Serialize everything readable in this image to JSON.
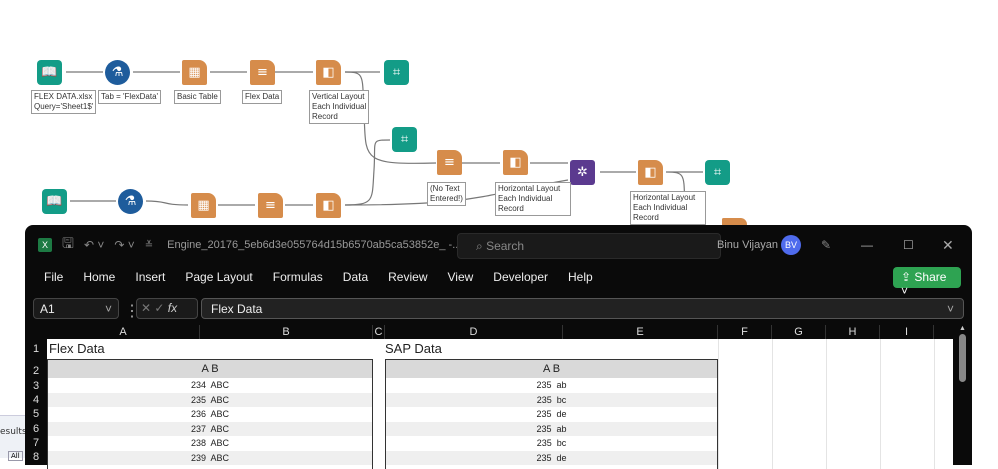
{
  "workflow": {
    "labels": {
      "input1": "FLEX DATA.xlsx\nQuery='Sheet1$'",
      "formula1": "Tab = 'FlexData'",
      "table1": "Basic Table",
      "filter1": "Flex Data",
      "layout1": "Vertical Layout\nEach Individual\nRecord",
      "filter2": "(No Text\nEntered!)",
      "layout2": "Horizontal Layout\nEach Individual\nRecord",
      "layout3": "Horizontal Layout\nEach Individual\nRecord"
    },
    "results_tab": "esults",
    "results_all": "All"
  },
  "excel": {
    "file_title": "Engine_20176_5eb6d3e055764d15b6570ab5ca53852e_  -...",
    "search_placeholder": "Search",
    "user_name": "Binu Vijayan",
    "user_initials": "BV",
    "menu": [
      "File",
      "Home",
      "Insert",
      "Page Layout",
      "Formulas",
      "Data",
      "Review",
      "View",
      "Developer",
      "Help"
    ],
    "share_label": "Share",
    "name_box": "A1",
    "formula_value": "Flex Data",
    "columns": [
      "A",
      "B",
      "C",
      "D",
      "E",
      "F",
      "G",
      "H",
      "I"
    ],
    "rows": [
      "1",
      "2",
      "3",
      "4",
      "5",
      "6",
      "7",
      "8"
    ],
    "flex": {
      "title": "Flex Data",
      "header": "A B",
      "rows": [
        "234  ABC",
        "235  ABC",
        "236  ABC",
        "237  ABC",
        "238  ABC",
        "239  ABC"
      ]
    },
    "sap": {
      "title": "SAP Data",
      "header": "A B",
      "rows": [
        "235  ab",
        "235  bc",
        "235  de",
        "235  ab",
        "235  bc",
        "235  de"
      ]
    }
  },
  "colors": {
    "teal": "#139c87",
    "orange": "#d68c4b",
    "purple": "#5b3a8f",
    "share": "#2ea352",
    "avatar": "#4f6bed"
  }
}
